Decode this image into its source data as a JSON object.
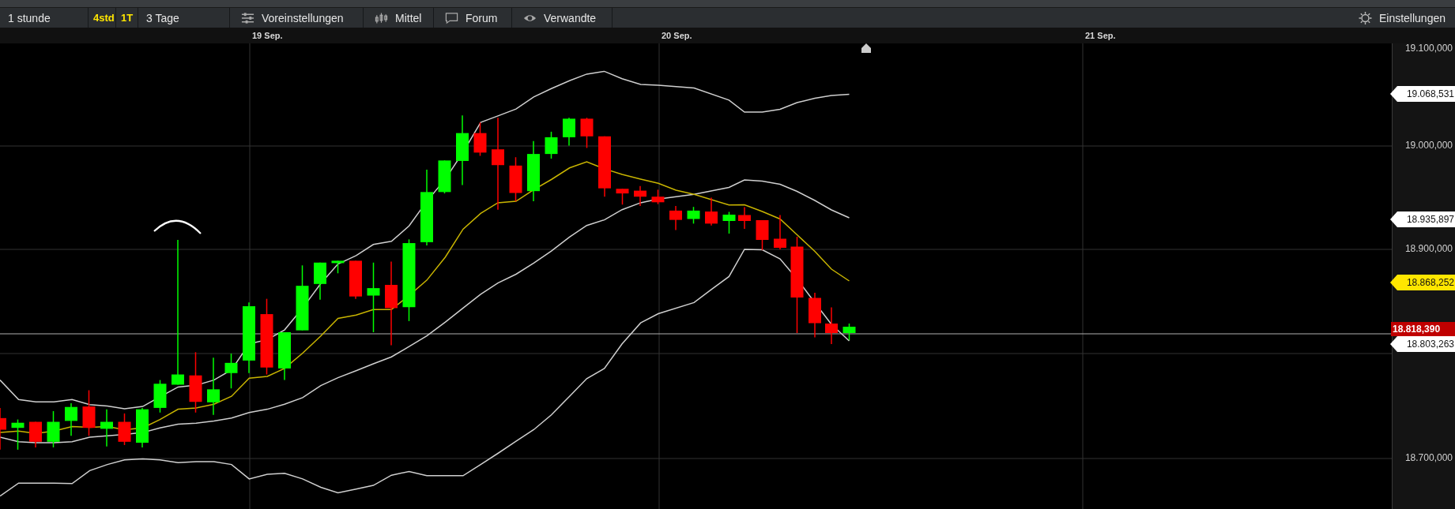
{
  "toolbar": {
    "periods": [
      {
        "label": "1 stunde",
        "kind": "period"
      },
      {
        "label": "4std",
        "kind": "shortcut"
      },
      {
        "label": "1T",
        "kind": "shortcut"
      },
      {
        "label": "3 Tage",
        "kind": "period"
      }
    ],
    "menus": [
      {
        "label": "Voreinstellungen"
      },
      {
        "label": "Mittel"
      },
      {
        "label": "Forum"
      },
      {
        "label": "Verwandte"
      }
    ],
    "settings": {
      "label": "Einstellungen"
    }
  },
  "chart": {
    "x_labels": [
      "19 Sep.",
      "20 Sep.",
      "21 Sep."
    ],
    "y_labels": [
      "19.100,000",
      "19.000,000",
      "18.900,000",
      "18.700,000"
    ],
    "price_tags": [
      {
        "label": "19.068,531",
        "kind": "band",
        "color": "#ffffff"
      },
      {
        "label": "18.935,897",
        "kind": "band",
        "color": "#ffffff"
      },
      {
        "label": "18.868,252",
        "kind": "band",
        "color": "#ffe600"
      },
      {
        "label": "18.818,390",
        "kind": "last",
        "color": "#c00000"
      },
      {
        "label": "18.803,263",
        "kind": "band",
        "color": "#ffffff"
      }
    ]
  }
}
